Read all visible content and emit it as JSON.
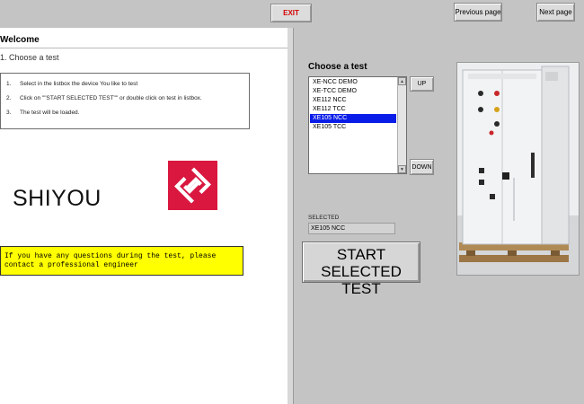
{
  "toolbar": {
    "exit_label": "EXIT",
    "prev_label": "Previous page",
    "next_label": "Next page"
  },
  "left": {
    "welcome": "Welcome",
    "step": "1.  Choose a test",
    "instructions": [
      {
        "num": "1.",
        "text": "Select in the listbox the device You like to test"
      },
      {
        "num": "2.",
        "text": "Click on \"\"START SELECTED TEST\"\" or double click on test in listbox."
      },
      {
        "num": "3.",
        "text": "The test will be loaded."
      }
    ],
    "brand": "SHIYOU",
    "help_note": "If you have any questions during the test, please contact a professional engineer"
  },
  "right": {
    "choose_title": "Choose a test",
    "tests": [
      "XE-NCC DEMO",
      "XE-TCC DEMO",
      "XE112 NCC",
      "XE112 TCC",
      "XE105 NCC",
      "XE105 TCC"
    ],
    "selected_index": 4,
    "up_label": "UP",
    "down_label": "DOWN",
    "selected_label": "SELECTED",
    "selected_value": "XE105 NCC",
    "start_label_line1": "START SELECTED",
    "start_label_line2": "TEST"
  },
  "colors": {
    "exit_text": "#d40000",
    "logo_bg": "#d9173f",
    "help_bg": "#ffff00",
    "selection_bg": "#0a1de8",
    "panel_bg": "#c4c4c4"
  },
  "icons": [
    "shiyou-logo-icon",
    "scroll-up-icon",
    "scroll-down-icon",
    "control-cabinet-photo"
  ]
}
